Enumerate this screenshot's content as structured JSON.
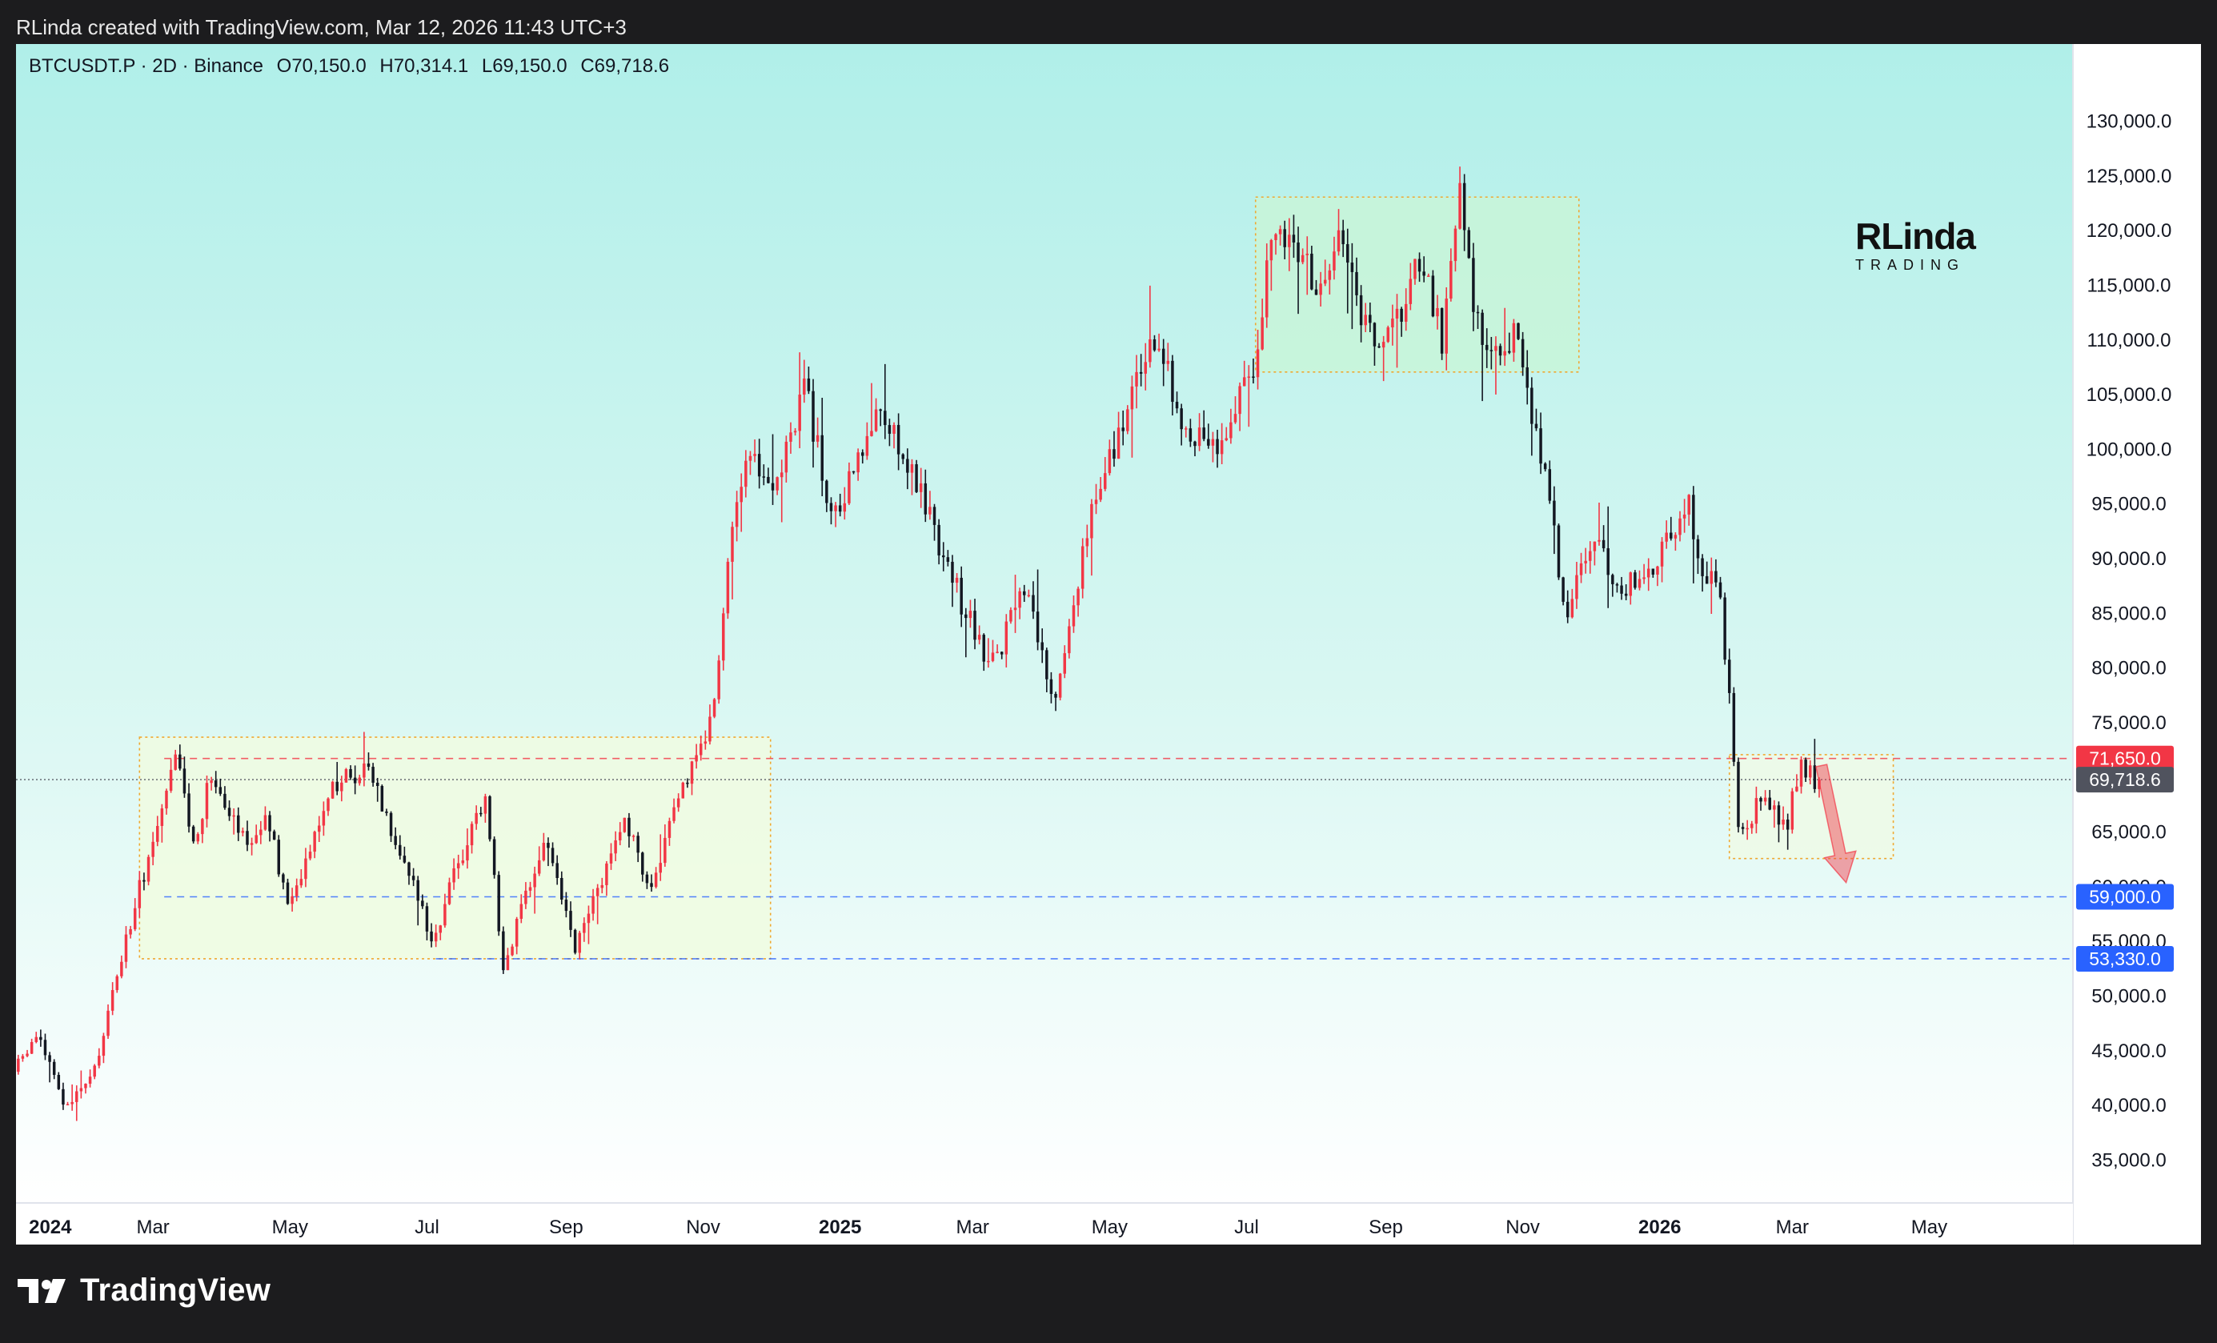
{
  "header": {
    "attribution": "RLinda created with TradingView.com, Mar 12, 2026 11:43 UTC+3"
  },
  "legend": {
    "symbol": "BTCUSDT.P · 2D · Binance",
    "open": "O70,150.0",
    "high": "H70,314.1",
    "low": "L69,150.0",
    "close": "C69,718.6"
  },
  "watermark": {
    "brand": "RLinda",
    "sub": "TRADING"
  },
  "footer": {
    "brand": "TradingView"
  },
  "colors": {
    "up": "#f23645",
    "down": "#131722",
    "bg_top": "#b0efe9",
    "bg_bottom": "#ffffff",
    "zone_green": "#c8f5d8",
    "zone_yellow": "#f0fbe0",
    "zone_border": "#f0a830",
    "blue_line": "#2962ff",
    "red_line": "#f23645"
  },
  "chart_data": {
    "type": "candlestick",
    "title": "BTCUSDT.P · 2D · Binance",
    "ylim": [
      31000,
      137000
    ],
    "y_ticks": [
      35000,
      40000,
      45000,
      50000,
      55000,
      60000,
      65000,
      70000,
      75000,
      80000,
      85000,
      90000,
      95000,
      100000,
      105000,
      110000,
      115000,
      120000,
      125000,
      130000
    ],
    "y_tick_labels": [
      "35,000.0",
      "40,000.0",
      "45,000.0",
      "50,000.0",
      "55,000.0",
      "60,000.0",
      "65,000.0",
      "70,000.0",
      "75,000.0",
      "80,000.0",
      "85,000.0",
      "90,000.0",
      "95,000.0",
      "100,000.0",
      "105,000.0",
      "110,000.0",
      "115,000.0",
      "120,000.0",
      "125,000.0",
      "130,000.0"
    ],
    "x_ticks": [
      {
        "label": "2024",
        "date": "2024-01-01",
        "bold": true
      },
      {
        "label": "Mar",
        "date": "2024-03-01",
        "bold": false
      },
      {
        "label": "May",
        "date": "2024-05-01",
        "bold": false
      },
      {
        "label": "Jul",
        "date": "2024-07-01",
        "bold": false
      },
      {
        "label": "Sep",
        "date": "2024-09-01",
        "bold": false
      },
      {
        "label": "Nov",
        "date": "2024-11-01",
        "bold": false
      },
      {
        "label": "2025",
        "date": "2025-01-01",
        "bold": true
      },
      {
        "label": "Mar",
        "date": "2025-03-01",
        "bold": false
      },
      {
        "label": "May",
        "date": "2025-05-01",
        "bold": false
      },
      {
        "label": "Jul",
        "date": "2025-07-01",
        "bold": false
      },
      {
        "label": "Sep",
        "date": "2025-09-01",
        "bold": false
      },
      {
        "label": "Nov",
        "date": "2025-11-01",
        "bold": false
      },
      {
        "label": "2026",
        "date": "2026-01-01",
        "bold": true
      },
      {
        "label": "Mar",
        "date": "2026-03-01",
        "bold": false
      },
      {
        "label": "May",
        "date": "2026-05-01",
        "bold": false
      }
    ],
    "xlim": [
      "2023-12-31",
      "2026-07-04"
    ],
    "path_anchors": [
      [
        "2023-12-31",
        43000
      ],
      [
        "2024-01-11",
        46500
      ],
      [
        "2024-01-23",
        39500
      ],
      [
        "2024-02-05",
        43000
      ],
      [
        "2024-02-15",
        52000
      ],
      [
        "2024-02-28",
        62000
      ],
      [
        "2024-03-05",
        66000
      ],
      [
        "2024-03-13",
        72000
      ],
      [
        "2024-03-20",
        63500
      ],
      [
        "2024-03-28",
        70500
      ],
      [
        "2024-04-13",
        64000
      ],
      [
        "2024-04-22",
        66000
      ],
      [
        "2024-05-01",
        58000
      ],
      [
        "2024-05-20",
        69000
      ],
      [
        "2024-06-06",
        71000
      ],
      [
        "2024-06-24",
        61000
      ],
      [
        "2024-07-05",
        55000
      ],
      [
        "2024-07-14",
        61000
      ],
      [
        "2024-07-28",
        68500
      ],
      [
        "2024-08-05",
        52500
      ],
      [
        "2024-08-24",
        64500
      ],
      [
        "2024-09-06",
        54000
      ],
      [
        "2024-09-27",
        66000
      ],
      [
        "2024-10-10",
        60000
      ],
      [
        "2024-10-29",
        72000
      ],
      [
        "2024-11-06",
        75000
      ],
      [
        "2024-11-13",
        90000
      ],
      [
        "2024-11-22",
        98500
      ],
      [
        "2024-12-05",
        97000
      ],
      [
        "2024-12-17",
        106000
      ],
      [
        "2024-12-30",
        93000
      ],
      [
        "2025-01-20",
        104000
      ],
      [
        "2025-02-03",
        98000
      ],
      [
        "2025-02-25",
        86000
      ],
      [
        "2025-03-10",
        80000
      ],
      [
        "2025-03-25",
        87000
      ],
      [
        "2025-04-08",
        76500
      ],
      [
        "2025-04-22",
        93000
      ],
      [
        "2025-05-10",
        104000
      ],
      [
        "2025-05-22",
        110000
      ],
      [
        "2025-06-05",
        102000
      ],
      [
        "2025-06-22",
        100500
      ],
      [
        "2025-07-05",
        108000
      ],
      [
        "2025-07-14",
        119500
      ],
      [
        "2025-07-28",
        118000
      ],
      [
        "2025-08-02",
        113500
      ],
      [
        "2025-08-13",
        121000
      ],
      [
        "2025-08-22",
        112000
      ],
      [
        "2025-09-01",
        108500
      ],
      [
        "2025-09-18",
        117500
      ],
      [
        "2025-09-27",
        109500
      ],
      [
        "2025-10-06",
        124500
      ],
      [
        "2025-10-10",
        113000
      ],
      [
        "2025-10-20",
        108000
      ],
      [
        "2025-10-29",
        111000
      ],
      [
        "2025-11-07",
        102000
      ],
      [
        "2025-11-14",
        96000
      ],
      [
        "2025-11-21",
        84000
      ],
      [
        "2025-12-02",
        91500
      ],
      [
        "2025-12-18",
        87000
      ],
      [
        "2026-01-05",
        91000
      ],
      [
        "2026-01-14",
        95500
      ],
      [
        "2026-01-20",
        89000
      ],
      [
        "2026-01-28",
        88000
      ],
      [
        "2026-02-05",
        70000
      ],
      [
        "2026-02-06",
        65000
      ],
      [
        "2026-02-17",
        68000
      ],
      [
        "2026-02-27",
        65000
      ],
      [
        "2026-03-05",
        71000
      ],
      [
        "2026-03-12",
        69718.6
      ]
    ],
    "levels": [
      {
        "value": 71650,
        "label": "71,650.0",
        "color": "#f23645",
        "style": "dashed",
        "from": "2024-03-06"
      },
      {
        "value": 69718.6,
        "label": "69,718.6",
        "color": "#50535e",
        "style": "dotted",
        "from": "2023-12-31"
      },
      {
        "value": 59000,
        "label": "59,000.0",
        "color": "#2962ff",
        "style": "dashed",
        "from": "2024-03-06"
      },
      {
        "value": 53330,
        "label": "53,330.0",
        "color": "#2962ff",
        "style": "dashed",
        "from": "2024-07-05"
      }
    ],
    "zones": [
      {
        "from": "2024-02-24",
        "to": "2024-12-01",
        "top": 73600,
        "bottom": 53330,
        "fill": "#f0fbe0"
      },
      {
        "from": "2025-07-05",
        "to": "2025-11-26",
        "top": 123000,
        "bottom": 107000,
        "fill": "#c8f5d8"
      },
      {
        "from": "2026-02-01",
        "to": "2026-04-15",
        "top": 72000,
        "bottom": 62500,
        "fill": "#eefae6"
      }
    ],
    "arrow": {
      "from_date": "2026-03-14",
      "from_value": 71000,
      "to_date": "2026-03-25",
      "to_value": 60300,
      "color": "#f23645"
    }
  }
}
